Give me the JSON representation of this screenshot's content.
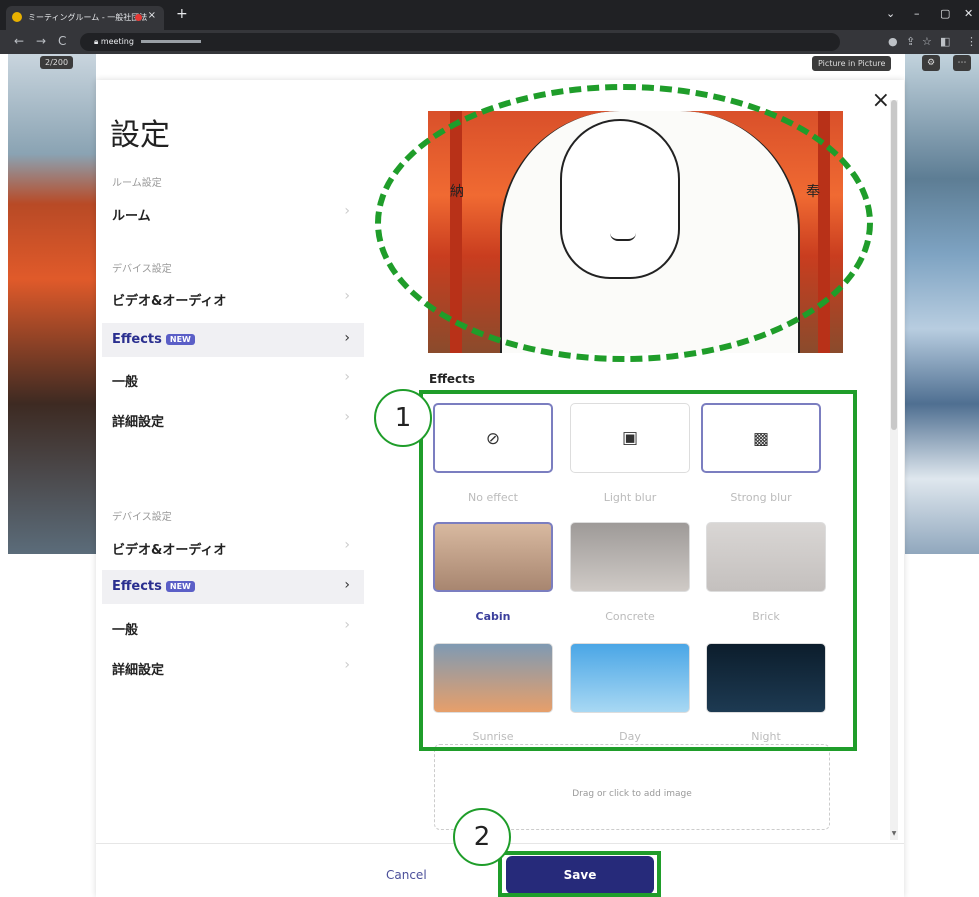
{
  "browser": {
    "tab_title": "ミーティングルーム - 一般社団法",
    "tab_close": "×",
    "new_tab": "+",
    "url": "meeting",
    "window_controls": [
      "⌄",
      "–",
      "▢",
      "✕"
    ],
    "nav": {
      "back": "←",
      "forward": "→",
      "reload": "C"
    }
  },
  "meeting": {
    "participant_counter": "2/200",
    "pip_button": "Picture in Picture",
    "settings_icon": "⚙",
    "more_icon": "⋯"
  },
  "dialog": {
    "title": "設定",
    "close": "×",
    "sections": [
      {
        "label": "ルーム設定"
      },
      {
        "label": "デバイス設定"
      },
      {
        "label": "デバイス設定"
      }
    ],
    "nav_items": [
      {
        "label": "ルーム",
        "chevron": "›"
      },
      {
        "label": "ビデオ&オーディオ",
        "chevron": "›"
      },
      {
        "label": "Effects",
        "badge": "NEW",
        "chevron": "›"
      },
      {
        "label": "一般",
        "chevron": "›"
      },
      {
        "label": "詳細設定",
        "chevron": "›"
      },
      {
        "label": "ビデオ&オーディオ",
        "chevron": "›"
      },
      {
        "label": "Effects",
        "badge": "NEW",
        "chevron": "›"
      },
      {
        "label": "一般",
        "chevron": "›"
      },
      {
        "label": "詳細設定",
        "chevron": "›"
      }
    ],
    "preview_kanji_left": "納",
    "preview_kanji_right": "奉",
    "effects_heading": "Effects",
    "effects": [
      {
        "label": "No effect",
        "glyph": "⊘",
        "selected": true
      },
      {
        "label": "Light blur",
        "glyph": "▣",
        "selected": false
      },
      {
        "label": "Strong blur",
        "glyph": "▩",
        "selected": false
      },
      {
        "label": "Cabin",
        "selected": true,
        "colors": [
          "#d8b9a0",
          "#a88670"
        ]
      },
      {
        "label": "Concrete",
        "selected": false,
        "colors": [
          "#9e9a98",
          "#cfcac6"
        ]
      },
      {
        "label": "Brick",
        "selected": false,
        "colors": [
          "#d9d6d4",
          "#c4c0be"
        ]
      },
      {
        "label": "Sunrise",
        "selected": false,
        "colors": [
          "#7f9ab3",
          "#e79f6a"
        ]
      },
      {
        "label": "Day",
        "selected": false,
        "colors": [
          "#4aa6e6",
          "#a8d8f3"
        ]
      },
      {
        "label": "Night",
        "selected": false,
        "colors": [
          "#0c1d2c",
          "#1d3a52"
        ]
      }
    ],
    "dropzone_text": "Drag or click to add image",
    "cancel_label": "Cancel",
    "save_label": "Save"
  },
  "annotations": {
    "num1": "1",
    "num2": "2",
    "color": "#1f9d2a"
  }
}
